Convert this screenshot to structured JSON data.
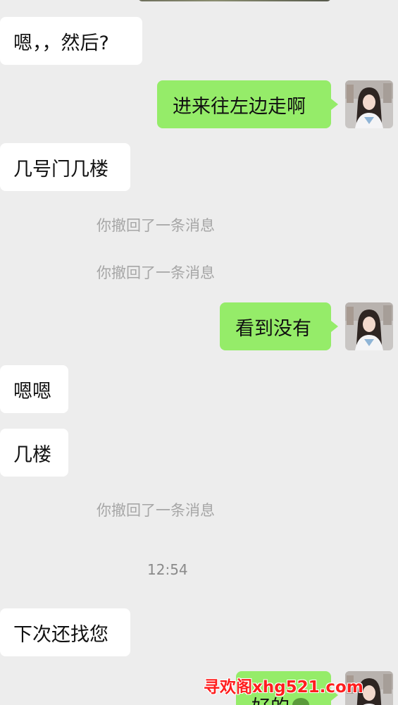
{
  "messages": {
    "m1": "嗯，，然后?",
    "m2": "进来往左边走啊",
    "m3": "几号门几楼",
    "r1": "你撤回了一条消息",
    "r2": "你撤回了一条消息",
    "m4": "看到没有",
    "m5": "嗯嗯",
    "m6": "几楼",
    "r3": "你撤回了一条消息",
    "time": "12:54",
    "m7": "下次还找您",
    "m8": "好的"
  },
  "watermark": "寻欢阁xhg521.com",
  "colors": {
    "background": "#ededed",
    "incoming_bubble": "#ffffff",
    "outgoing_bubble": "#95ec69",
    "system_text": "#a6a6a6",
    "watermark": "#ff1e1e"
  },
  "icons": {
    "avatar": "avatar-photo-icon",
    "emoji": "emoji-icon"
  }
}
